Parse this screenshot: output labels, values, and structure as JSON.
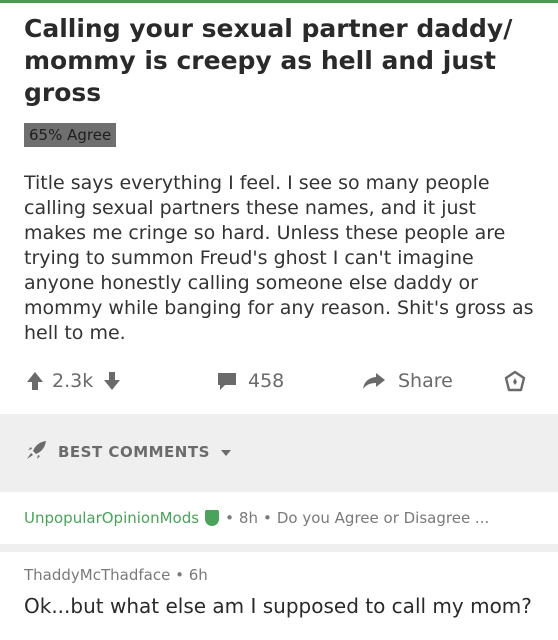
{
  "post": {
    "title": "Calling your sexual partner daddy/ mommy is creepy as hell and just gross",
    "agree_badge": "65% Agree",
    "body": "Title says everything I feel. I see so many people calling sexual partners these names, and it just makes me cringe so hard. Unless these people are trying to summon Freud's ghost I can't imagine anyone honestly calling someone else daddy or mommy while banging for any reason. Shit's gross as hell to me."
  },
  "actions": {
    "score": "2.3k",
    "comments": "458",
    "share": "Share"
  },
  "comments_header": {
    "sort_label": "BEST COMMENTS"
  },
  "mod_comment": {
    "author": "UnpopularOpinionMods",
    "time": "8h",
    "preview": "Do you Agree or Disagree ..."
  },
  "comment": {
    "author": "ThaddyMcThadface",
    "time": "6h",
    "text": "Ok...but what else am I supposed to call my mom?"
  }
}
